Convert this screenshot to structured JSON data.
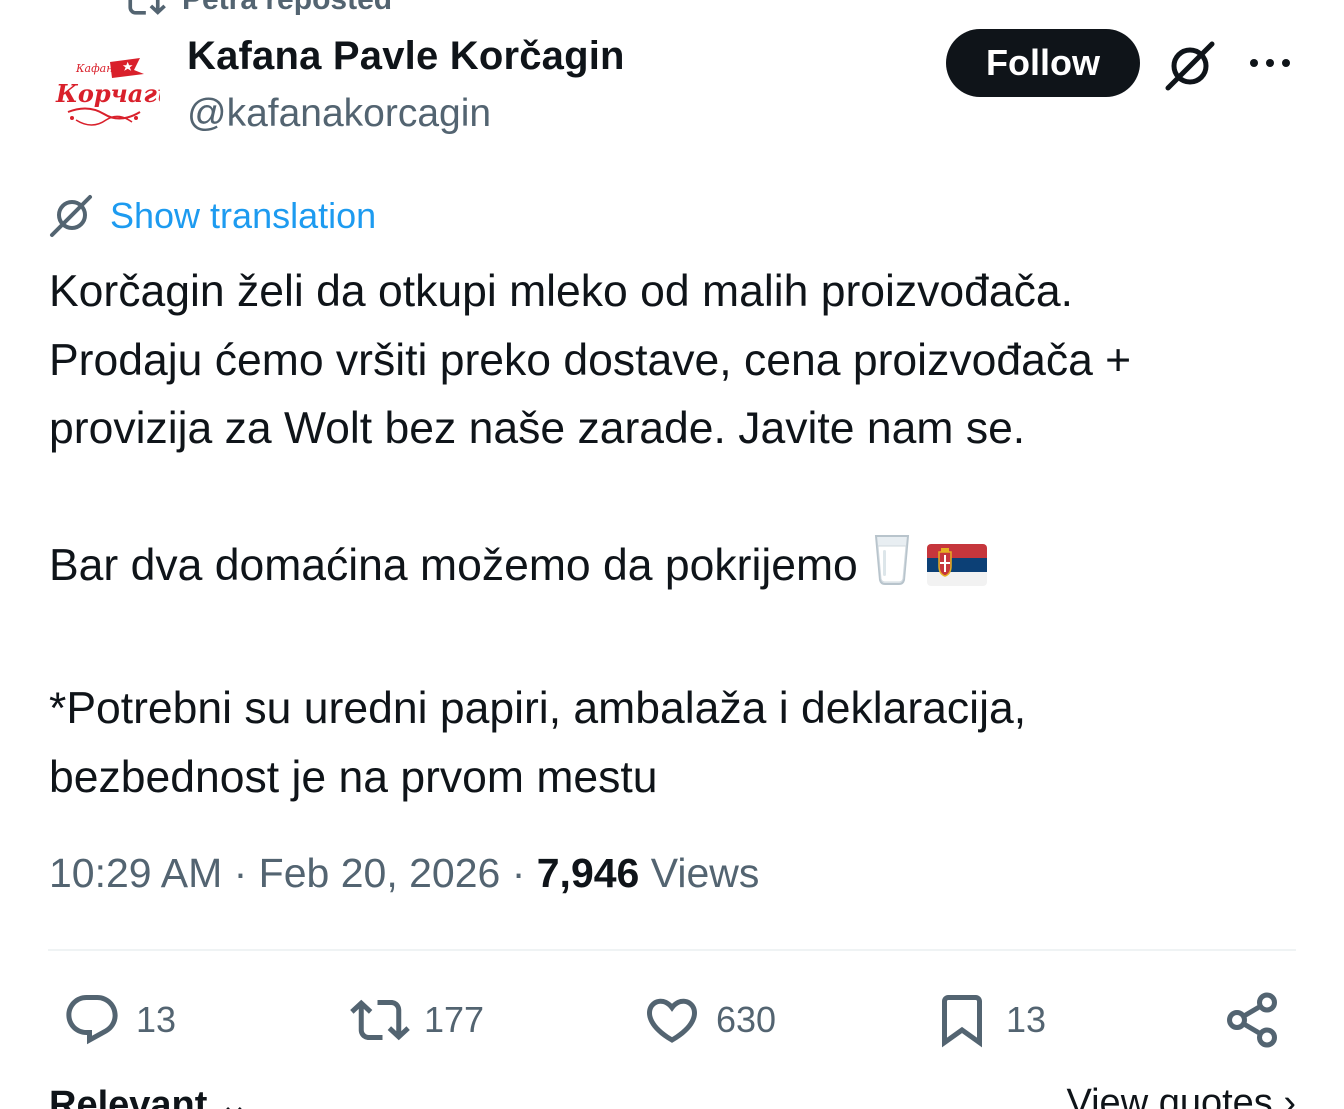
{
  "repost_banner": {
    "text": "Petra reposted",
    "icon": "repost-icon"
  },
  "author": {
    "name": "Kafana Pavle Korčagin",
    "handle": "@kafanakorcagin",
    "avatar_text": "Korčagin"
  },
  "header": {
    "follow_label": "Follow",
    "grok_icon": "grok-icon",
    "more_icon": "more-icon"
  },
  "translation": {
    "label": "Show translation",
    "icon": "grok-icon"
  },
  "tweet": {
    "line1": "Korčagin želi da otkupi mleko od malih proizvođača.",
    "line2": "Prodaju ćemo vršiti preko dostave, cena proizvođača +",
    "line3": "provizija za Wolt bez naše zarade. Javite nam se.",
    "line4": "Bar dva domaćina možemo da pokrijemo",
    "line5": "*Potrebni su uredni papiri, ambalaža i deklaracija,",
    "line6": "bezbednost je na prvom mestu",
    "emojis": [
      "glass-of-milk-emoji",
      "serbia-flag-emoji"
    ]
  },
  "meta": {
    "time": "10:29 AM",
    "sep1": " · ",
    "date": "Feb 20, 2026",
    "sep2": " · ",
    "views_count": "7,946",
    "views_label": " Views"
  },
  "actions": {
    "replies": "13",
    "reposts": "177",
    "likes": "630",
    "bookmarks": "13"
  },
  "bottom": {
    "left": "Relevant",
    "right": "View quotes"
  },
  "colors": {
    "accent": "#1d9bf0",
    "text": "#0f1419",
    "secondary": "#536471",
    "divider": "#eff3f4"
  }
}
